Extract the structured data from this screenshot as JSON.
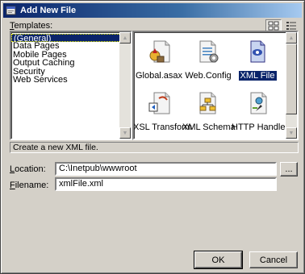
{
  "window": {
    "title": "Add New File"
  },
  "templates_label": "Templates:",
  "view_buttons": {
    "large_icons": "large-icons-view",
    "small_list": "small-list-view"
  },
  "categories": [
    {
      "label": "(General)",
      "selected": true
    },
    {
      "label": "Data Pages"
    },
    {
      "label": "Mobile Pages"
    },
    {
      "label": "Output Caching"
    },
    {
      "label": "Security"
    },
    {
      "label": "Web Services"
    }
  ],
  "templates": [
    {
      "label": "Global.asax",
      "icon": "global-asax-icon"
    },
    {
      "label": "Web.Config",
      "icon": "web-config-icon"
    },
    {
      "label": "XML File",
      "icon": "xml-file-icon",
      "selected": true
    },
    {
      "label": "XSL Transform",
      "icon": "xsl-transform-icon"
    },
    {
      "label": "XML Schema",
      "icon": "xml-schema-icon"
    },
    {
      "label": "HTTP Handler",
      "icon": "http-handler-icon"
    }
  ],
  "description": "Create a new XML file.",
  "location": {
    "label": "Location:",
    "value": "C:\\Inetpub\\wwwroot",
    "browse": "..."
  },
  "filename": {
    "label": "Filename:",
    "value": "xmlFile.xml"
  },
  "buttons": {
    "ok": "OK",
    "cancel": "Cancel"
  }
}
